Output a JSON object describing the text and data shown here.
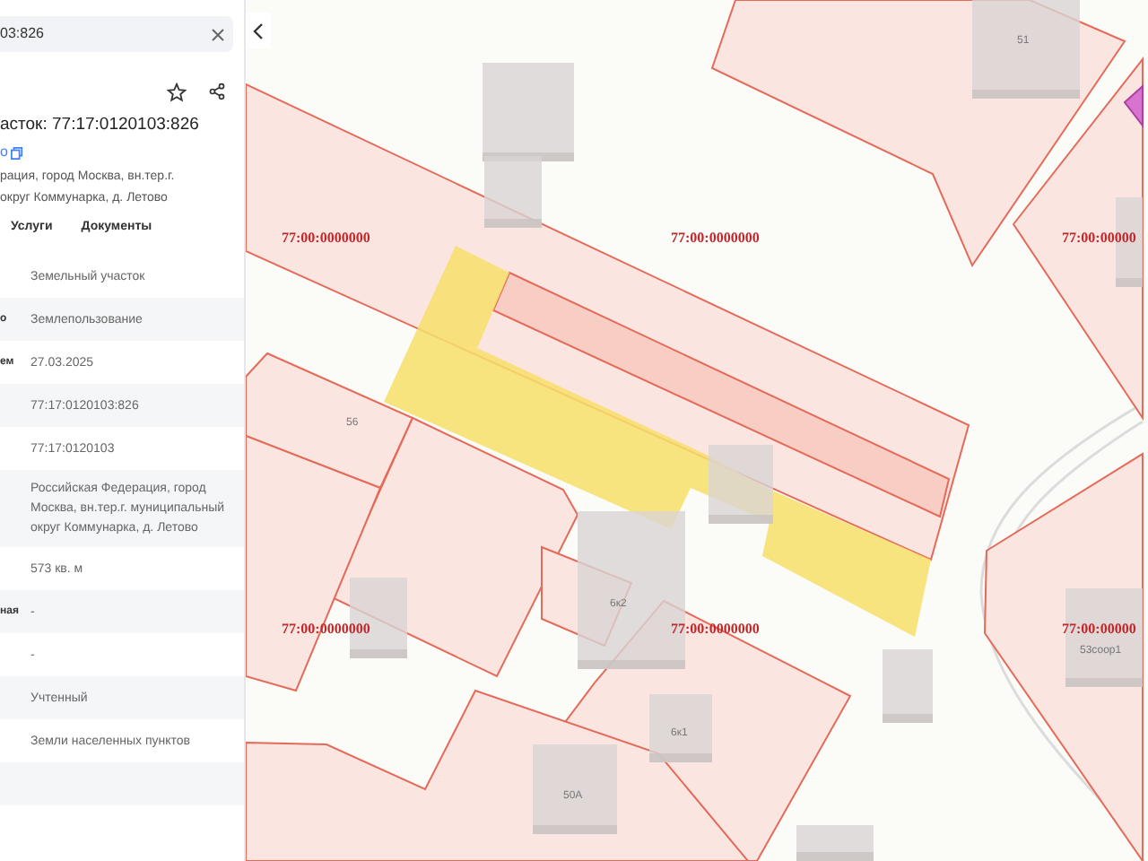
{
  "panel": {
    "search": {
      "value": "03:826"
    },
    "title": "асток: 77:17:0120103:826",
    "link": "о",
    "address": [
      "рация, город Москва, вн.тер.г.",
      "округ Коммунарка, д. Летово"
    ],
    "tabs": [
      {
        "label": "Услуги",
        "selected": false
      },
      {
        "label": "Документы",
        "selected": false
      }
    ],
    "rows": [
      {
        "label": "",
        "value": "Земельный участок"
      },
      {
        "label": "о",
        "value": "Землепользование"
      },
      {
        "label": "ем",
        "value": "27.03.2025"
      },
      {
        "label": "",
        "value": "77:17:0120103:826"
      },
      {
        "label": "",
        "value": "77:17:0120103"
      },
      {
        "label": "",
        "value": "Российская Федерация, город Москва, вн.тер.г. муниципальный округ Коммунарка, д. Летово"
      },
      {
        "label": "",
        "value": "573 кв. м"
      },
      {
        "label": "ная",
        "value": "-"
      },
      {
        "label": "",
        "value": "-"
      },
      {
        "label": "",
        "value": "Учтенный"
      },
      {
        "label": "",
        "value": "Земли населенных пунктов"
      },
      {
        "label": "",
        "value": ""
      }
    ]
  },
  "map": {
    "parcel_labels": [
      "77:00:0000000",
      "77:00:0000000",
      "77:00:00000",
      "77:00:0000000",
      "77:00:0000000",
      "77:00:00000"
    ],
    "house_numbers": [
      "51",
      "56",
      "6к2",
      "6к1",
      "50А",
      "53соор1"
    ]
  }
}
